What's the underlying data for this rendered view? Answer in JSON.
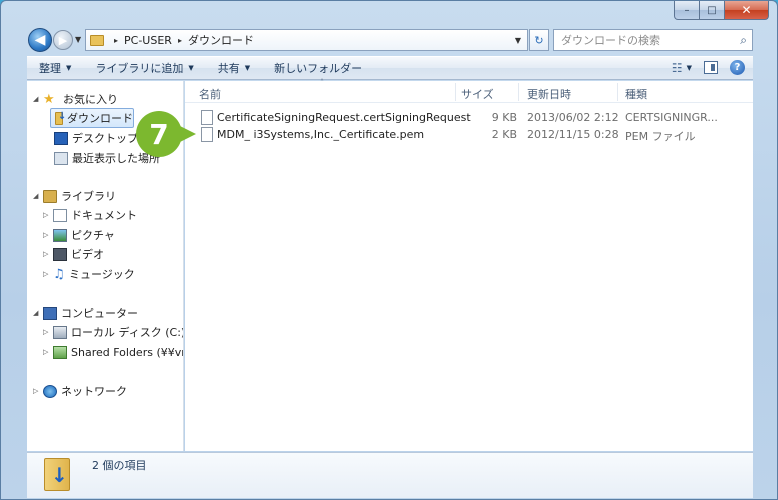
{
  "window": {
    "caption": {
      "minimize": "–",
      "maximize": "□",
      "close": "✕"
    }
  },
  "navigation": {
    "back_glyph": "◀",
    "forward_glyph": "▶",
    "history_glyph": "▼",
    "address": {
      "sep1": "▸",
      "segment1": "PC-USER",
      "sep2": "▸",
      "segment2": "ダウンロード",
      "dropdown_glyph": "▼"
    },
    "refresh_glyph": "↻",
    "search_placeholder": "ダウンロードの検索",
    "search_icon_glyph": "⌕"
  },
  "toolbar": {
    "organize": "整理",
    "add_to_library": "ライブラリに追加",
    "share": "共有",
    "new_folder": "新しいフォルダー",
    "dropdown_glyph": "▼",
    "view_glyph": "☷",
    "help_glyph": "?"
  },
  "sidebar": {
    "favorites": {
      "label": "お気に入り",
      "expander": "◢"
    },
    "downloads": "ダウンロード",
    "desktop": "デスクトップ",
    "recent": "最近表示した場所",
    "libraries": {
      "label": "ライブラリ",
      "expander": "◢"
    },
    "documents": {
      "label": "ドキュメント",
      "expander": "▷"
    },
    "pictures": {
      "label": "ピクチャ",
      "expander": "▷"
    },
    "videos": {
      "label": "ビデオ",
      "expander": "▷"
    },
    "music": {
      "label": "ミュージック",
      "expander": "▷",
      "icon_glyph": "♫"
    },
    "computer": {
      "label": "コンピューター",
      "expander": "◢"
    },
    "local_disk": {
      "label": "ローカル ディスク (C:)",
      "expander": "▷"
    },
    "shared_folders": {
      "label": "Shared Folders (¥¥vmw",
      "expander": "▷"
    },
    "network": {
      "label": "ネットワーク",
      "expander": "▷"
    },
    "favorites_star_glyph": "★"
  },
  "step_badge": {
    "number": "7"
  },
  "columns": {
    "name": "名前",
    "size": "サイズ",
    "date": "更新日時",
    "type": "種類",
    "sort_glyph": "˄"
  },
  "files": [
    {
      "name": "CertificateSigningRequest.certSigningRequest",
      "size": "9 KB",
      "date": "2013/06/02 2:12",
      "type": "CERTSIGNINGR..."
    },
    {
      "name": "MDM_ i3Systems,Inc._Certificate.pem",
      "size": "2 KB",
      "date": "2012/11/15 0:28",
      "type": "PEM ファイル"
    }
  ],
  "details": {
    "item_count": "2 個の項目"
  }
}
